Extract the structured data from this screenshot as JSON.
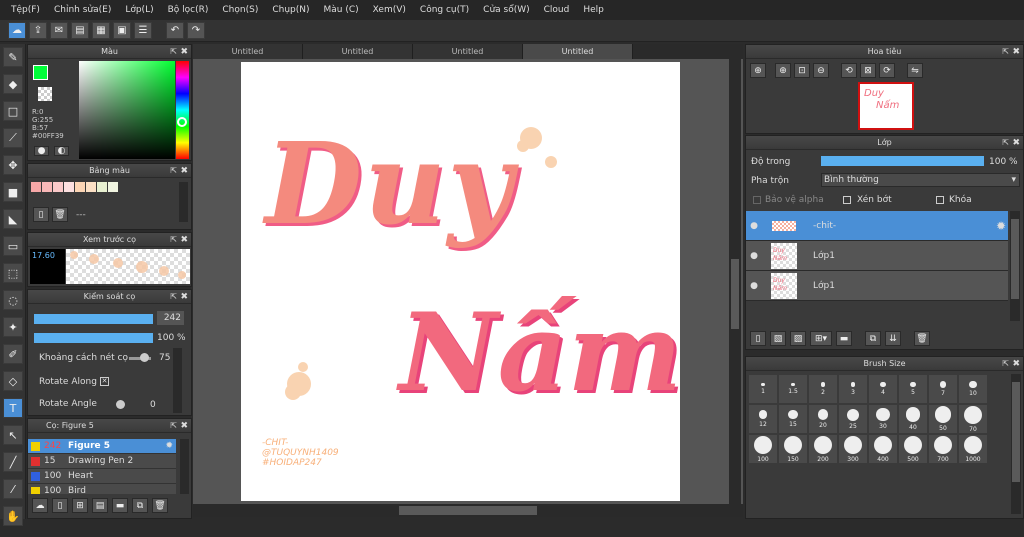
{
  "menu": [
    "Tệp(F)",
    "Chỉnh sửa(E)",
    "Lớp(L)",
    "Bộ lọc(R)",
    "Chọn(S)",
    "Chụp(N)",
    "Màu (C)",
    "Xem(V)",
    "Công cụ(T)",
    "Cửa sổ(W)",
    "Cloud",
    "Help"
  ],
  "tabs": [
    "Untitled",
    "Untitled",
    "Untitled",
    "Untitled"
  ],
  "color_panel": {
    "title": "Màu",
    "r": "R:0",
    "g": "G:255",
    "b": "B:57",
    "hex": "#00FF39",
    "fg_color": "#00FF39"
  },
  "palette_panel": {
    "title": "Bảng màu",
    "dash": "---",
    "swatches": [
      "#f7a8a8",
      "#f9b8b8",
      "#fbc9c9",
      "#fde0e0",
      "#fcd5b5",
      "#fce0c5",
      "#e8f0d0",
      "#f0f4e0"
    ]
  },
  "preview_panel": {
    "title": "Xem trước cọ",
    "size": "17.60"
  },
  "brush_control": {
    "title": "Kiểm soát cọ",
    "size_value": "242",
    "opacity_value": "100 %",
    "spacing_label": "Khoảng cách nét cọ",
    "spacing_value": "75",
    "rotate_along_label": "Rotate Along",
    "rotate_angle_label": "Rotate Angle",
    "rotate_angle_value": "0"
  },
  "brush_list": {
    "title": "Cọ: Figure 5",
    "items": [
      {
        "size": "242",
        "name": "Figure 5",
        "color": "#f0d000"
      },
      {
        "size": "15",
        "name": "Drawing Pen 2",
        "color": "#e03030"
      },
      {
        "size": "100",
        "name": "Heart",
        "color": "#3060e0"
      },
      {
        "size": "100",
        "name": "Bird",
        "color": "#f0d000"
      }
    ]
  },
  "canvas_art": {
    "line1": "Duy",
    "line2": "Nấm",
    "sig1": "-CHIT-",
    "sig2": "@TUQUYNH1409",
    "sig3": "#HOIDAP247"
  },
  "navigator": {
    "title": "Hoa tiêu"
  },
  "layers_panel": {
    "title": "Lớp",
    "opacity_label": "Độ trong",
    "opacity_value": "100 %",
    "blend_label": "Pha trộn",
    "blend_value": "Bình thường",
    "protect_alpha": "Bảo vệ alpha",
    "clipping": "Xén bớt",
    "lock": "Khóa",
    "layers": [
      "-chit-",
      "Lớp1",
      "Lớp1"
    ]
  },
  "brush_size": {
    "title": "Brush Size",
    "sizes": [
      "1",
      "1.5",
      "2",
      "3",
      "4",
      "5",
      "7",
      "10",
      "12",
      "15",
      "20",
      "25",
      "30",
      "40",
      "50",
      "70",
      "100",
      "150",
      "200",
      "300",
      "400",
      "500",
      "700",
      "1000"
    ]
  }
}
